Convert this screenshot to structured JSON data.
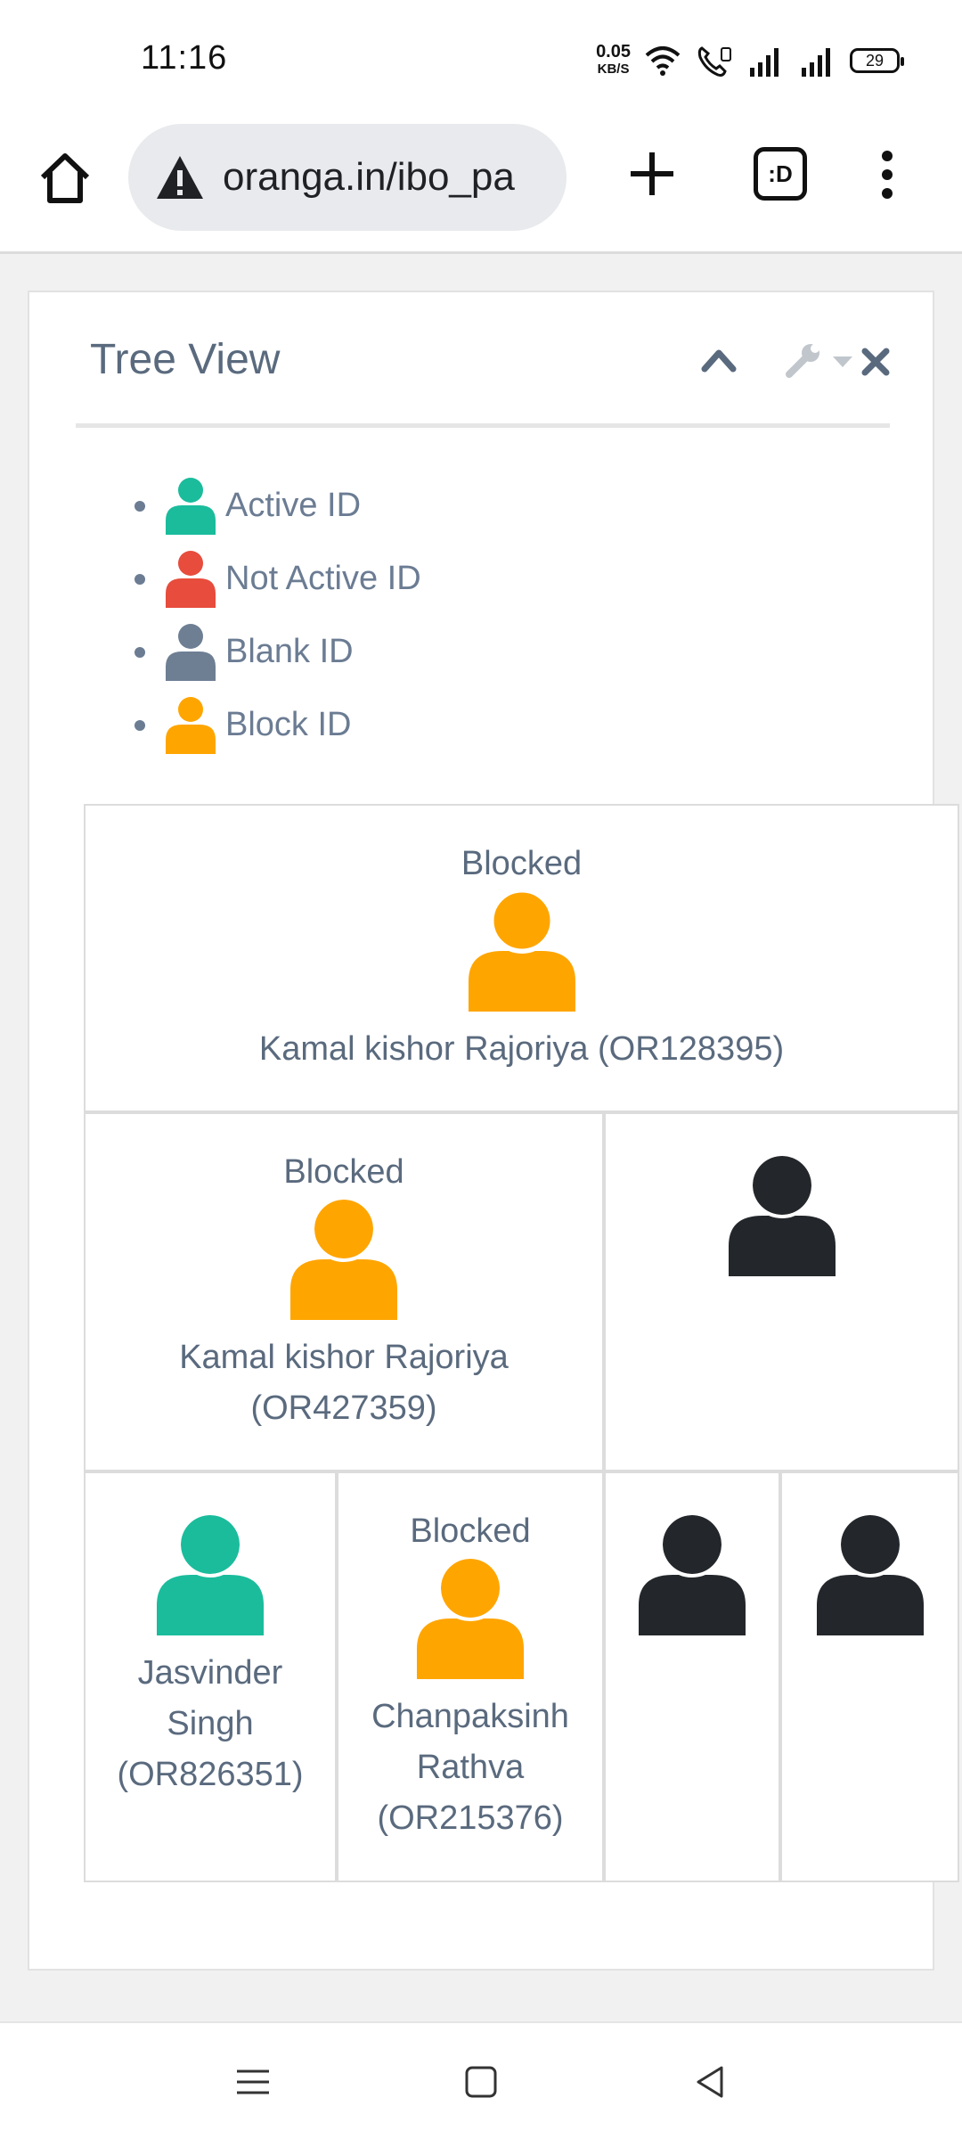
{
  "status_bar": {
    "time": "11:16",
    "net_speed": "0.05",
    "net_unit": "KB/S",
    "battery": "29"
  },
  "browser": {
    "url": "oranga.in/ibo_pa",
    "tabs_label": ":D"
  },
  "panel": {
    "title": "Tree View"
  },
  "legend": [
    {
      "label": "Active ID",
      "color": "#1abc9c"
    },
    {
      "label": "Not Active ID",
      "color": "#e74c3c"
    },
    {
      "label": "Blank ID",
      "color": "#6e7f94"
    },
    {
      "label": "Block ID",
      "color": "#ffa500"
    }
  ],
  "tree": {
    "nodes": [
      {
        "status": "Blocked",
        "name": "Kamal kishor Rajoriya (OR128395)",
        "color": "#ffa500"
      },
      {
        "status": "Blocked",
        "name_line1": "Kamal kishor Rajoriya",
        "name_line2": "(OR427359)",
        "color": "#ffa500"
      },
      {
        "status": "",
        "name": "",
        "color": "#23272b"
      },
      {
        "status": "",
        "name_line1": "Jasvinder",
        "name_line2": "Singh",
        "name_line3": "(OR826351)",
        "color": "#1abc9c"
      },
      {
        "status": "Blocked",
        "name_line1": "Chanpaksinh",
        "name_line2": "Rathva",
        "name_line3": "(OR215376)",
        "color": "#ffa500"
      },
      {
        "status": "",
        "name": "",
        "color": "#23272b"
      },
      {
        "status": "",
        "name": "",
        "color": "#23272b"
      }
    ]
  },
  "colors": {
    "active": "#1abc9c",
    "not_active": "#e74c3c",
    "blank": "#6e7f94",
    "block": "#ffa500",
    "empty_slot": "#23272b"
  }
}
